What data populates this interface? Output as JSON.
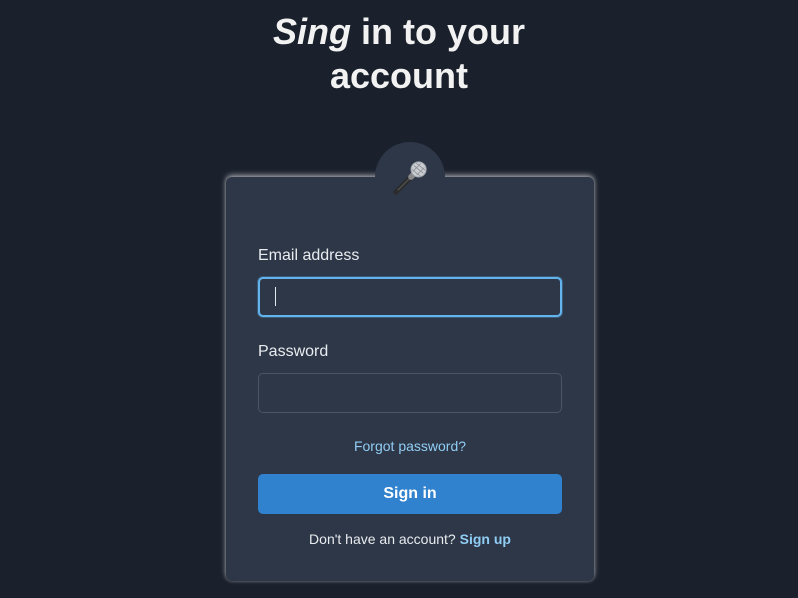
{
  "header": {
    "title_em": "Sing",
    "title_rest_1": " in to your",
    "title_line_2": "account"
  },
  "badge": {
    "icon": "microphone-icon"
  },
  "form": {
    "email_label": "Email address",
    "email_value": "",
    "password_label": "Password",
    "password_value": "",
    "forgot_link": "Forgot password?",
    "submit_label": "Sign in",
    "signup_prompt": "Don't have an account?",
    "signup_link": "Sign up"
  },
  "colors": {
    "background": "#1a202c",
    "card": "#2d3748",
    "accent": "#3182ce",
    "link": "#90cdf4",
    "focus": "#63b3ed"
  }
}
